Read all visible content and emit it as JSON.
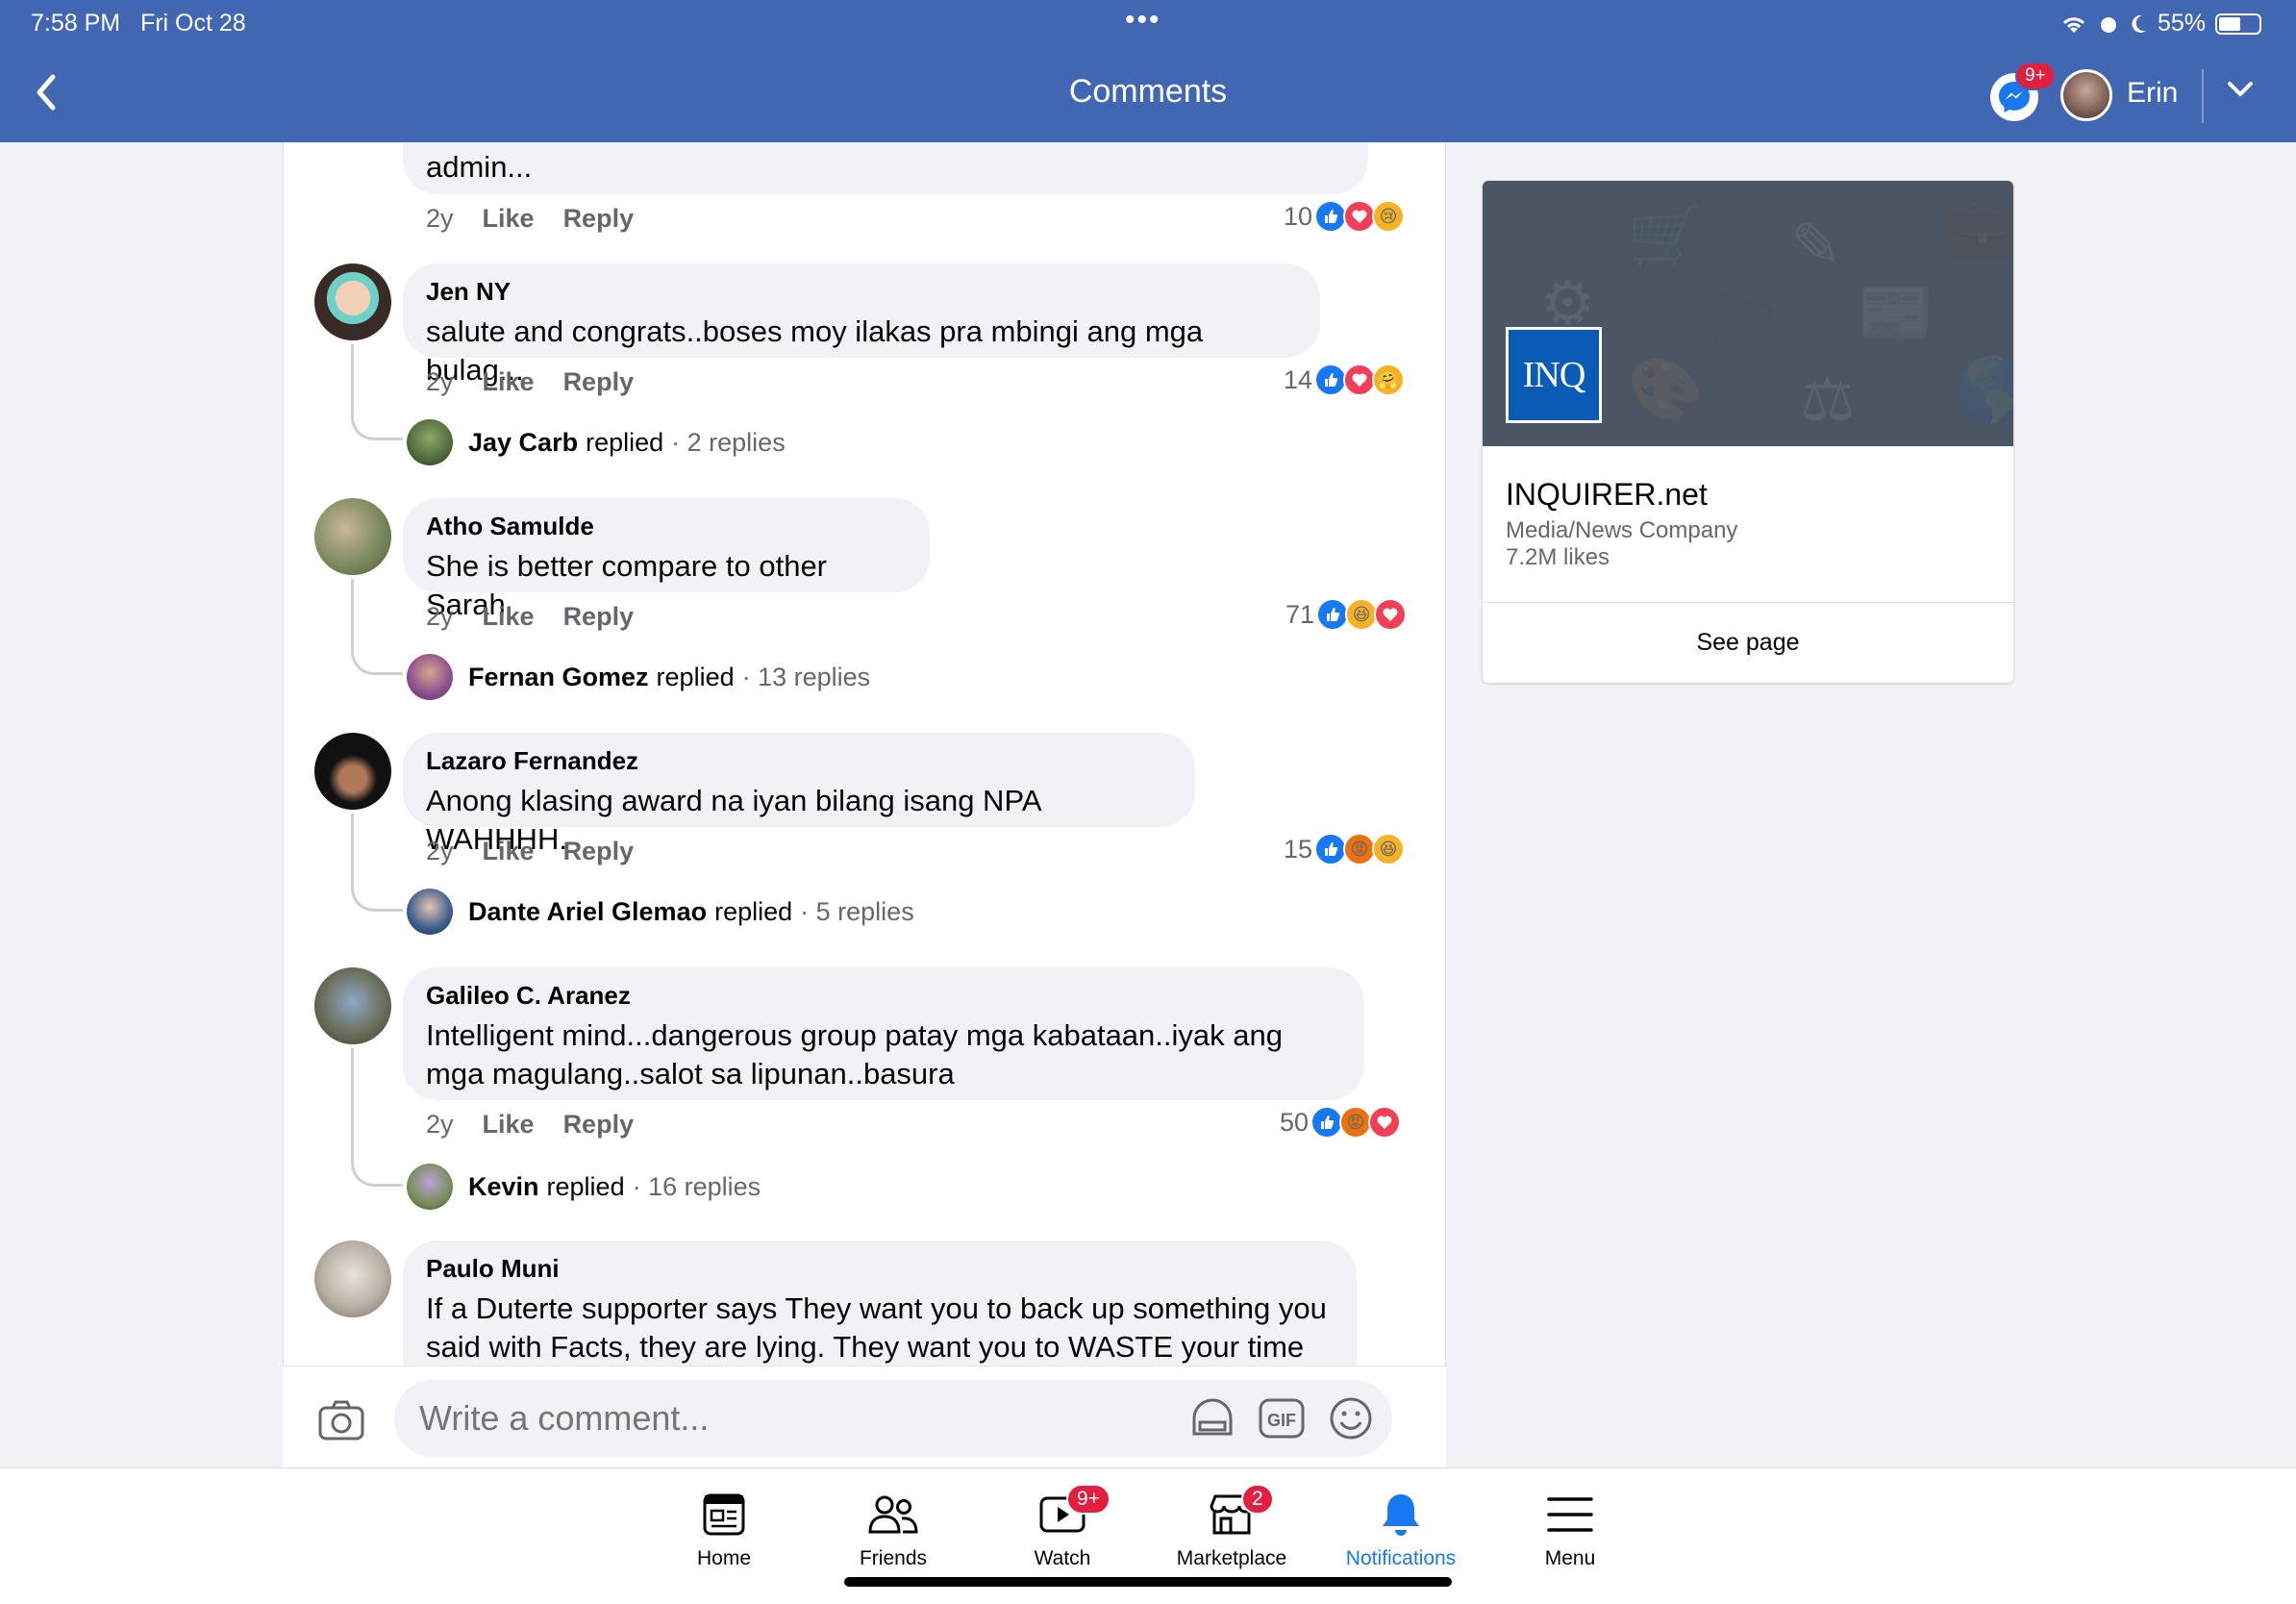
{
  "status": {
    "time": "7:58 PM",
    "date": "Fri Oct 28",
    "battery": "55%"
  },
  "header": {
    "title": "Comments",
    "messenger_badge": "9+",
    "user_name": "Erin"
  },
  "comments": [
    {
      "author": "",
      "text": "admin...",
      "age": "2y",
      "like": "Like",
      "reply": "Reply",
      "reaction_count": "10",
      "reactions": [
        "like-icon",
        "love-icon",
        "sad-icon"
      ]
    },
    {
      "author": "Jen NY",
      "text": "salute and congrats..boses moy ilakas pra mbingi ang mga bulag...",
      "age": "2y",
      "like": "Like",
      "reply": "Reply",
      "reaction_count": "14",
      "reactions": [
        "like-icon",
        "love-icon",
        "care-icon"
      ],
      "replies": {
        "name": "Jay Carb",
        "verb": "replied",
        "count": "· 2 replies"
      }
    },
    {
      "author": "Atho Samulde",
      "text": "She is better compare to other Sarah",
      "age": "2y",
      "like": "Like",
      "reply": "Reply",
      "reaction_count": "71",
      "reactions": [
        "like-icon",
        "haha-icon",
        "love-icon"
      ],
      "replies": {
        "name": "Fernan Gomez",
        "verb": "replied",
        "count": "· 13 replies"
      }
    },
    {
      "author": "Lazaro Fernandez",
      "text": "Anong klasing award na iyan bilang isang NPA WAHHHH.",
      "age": "2y",
      "like": "Like",
      "reply": "Reply",
      "reaction_count": "15",
      "reactions": [
        "like-icon",
        "angry-icon",
        "haha-icon"
      ],
      "replies": {
        "name": "Dante Ariel Glemao",
        "verb": "replied",
        "count": "· 5 replies"
      }
    },
    {
      "author": "Galileo C. Aranez",
      "text": "Intelligent mind...dangerous group patay mga kabataan..iyak ang mga magulang..salot sa lipunan..basura",
      "age": "2y",
      "like": "Like",
      "reply": "Reply",
      "reaction_count": "50",
      "reactions": [
        "like-icon",
        "angry-icon",
        "love-icon"
      ],
      "replies": {
        "name": "Kevin",
        "verb": "replied",
        "count": "· 16 replies"
      }
    },
    {
      "author": "Paulo Muni",
      "text": "If a Duterte supporter says They want you  to back up something you said with Facts,  they are lying. They want you to WASTE your time"
    }
  ],
  "composer": {
    "placeholder": "Write a comment..."
  },
  "page_card": {
    "logo_text": "INQ",
    "name": "INQUIRER.net",
    "category": "Media/News Company",
    "likes": "7.2M likes",
    "button": "See page"
  },
  "tabs": [
    {
      "label": "Home",
      "icon": "home-icon"
    },
    {
      "label": "Friends",
      "icon": "friends-icon"
    },
    {
      "label": "Watch",
      "icon": "watch-icon",
      "badge": "9+"
    },
    {
      "label": "Marketplace",
      "icon": "marketplace-icon",
      "badge": "2"
    },
    {
      "label": "Notifications",
      "icon": "bell-icon",
      "active": true
    },
    {
      "label": "Menu",
      "icon": "menu-icon"
    }
  ],
  "colors": {
    "brand_blue": "#4267b2",
    "link_blue": "#1877f2",
    "badge_red": "#e41e3f"
  }
}
